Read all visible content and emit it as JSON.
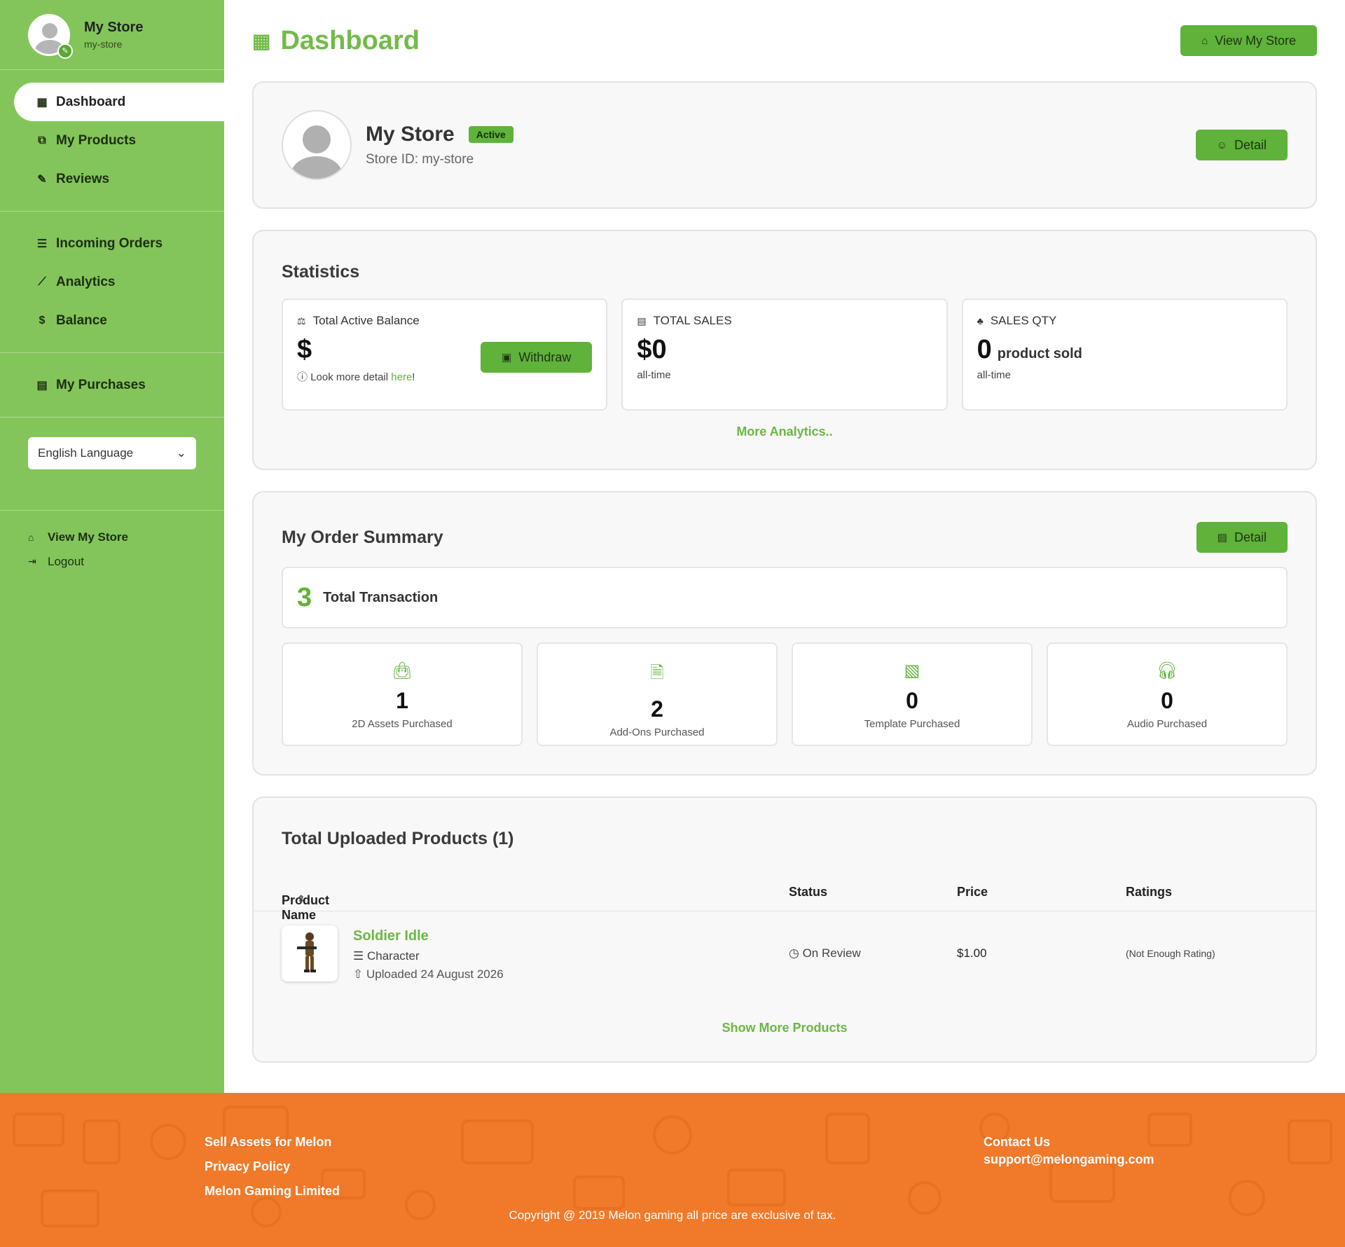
{
  "colors": {
    "sidebar": "#83c55a",
    "accent": "#5fb23a",
    "footer": "#f07a2a"
  },
  "sidebar": {
    "store_name": "My Store",
    "store_slug": "my-store",
    "nav_main": [
      {
        "label": "Dashboard",
        "icon": "dashboard-icon"
      },
      {
        "label": "My Products",
        "icon": "products-icon"
      },
      {
        "label": "Reviews",
        "icon": "pencil-icon"
      }
    ],
    "nav_orders": [
      {
        "label": "Incoming Orders",
        "icon": "list-icon"
      },
      {
        "label": "Analytics",
        "icon": "chart-icon"
      },
      {
        "label": "Balance",
        "icon": "dollar-icon"
      }
    ],
    "nav_purchases": [
      {
        "label": "My Purchases",
        "icon": "clipboard-icon"
      }
    ],
    "language": "English Language",
    "view_store": "View My Store",
    "logout": "Logout"
  },
  "header": {
    "title": "Dashboard",
    "view_store_btn": "View My Store"
  },
  "store": {
    "name": "My Store",
    "status": "Active",
    "store_id": "Store ID: my-store",
    "detail_btn": "Detail"
  },
  "statistics": {
    "title": "Statistics",
    "balance": {
      "label": "Total Active Balance",
      "value": "$",
      "withdraw": "Withdraw",
      "note_prefix": "Look more detail ",
      "note_link": "here",
      "note_suffix": "!"
    },
    "sales": {
      "label": "TOTAL SALES",
      "value": "$0",
      "sub": "all-time"
    },
    "qty": {
      "label": "SALES QTY",
      "value": "0",
      "unit": "product sold",
      "sub": "all-time"
    },
    "more": "More Analytics.."
  },
  "orders": {
    "title": "My Order Summary",
    "detail_btn": "Detail",
    "total_count": "3",
    "total_label": "Total Transaction",
    "categories": [
      {
        "count": "1",
        "label": "2D Assets Purchased",
        "icon": "shopping-bag-icon"
      },
      {
        "count": "2",
        "label": "Add-Ons Purchased",
        "icon": "document-icon"
      },
      {
        "count": "0",
        "label": "Template Purchased",
        "icon": "images-icon"
      },
      {
        "count": "0",
        "label": "Audio Purchased",
        "icon": "headphones-icon"
      }
    ]
  },
  "products": {
    "title": "Total Uploaded Products (1)",
    "columns": [
      "Product Name",
      "Status",
      "Price",
      "Ratings"
    ],
    "rows": [
      {
        "name": "Soldier Idle",
        "category": "Character",
        "uploaded": "Uploaded 24 August 2026",
        "status": "On Review",
        "price": "$1.00",
        "rating": "(Not Enough Rating)"
      }
    ],
    "show_more": "Show More Products"
  },
  "footer": {
    "links": [
      "Sell Assets for Melon",
      "Privacy Policy",
      "Melon Gaming Limited"
    ],
    "contact_title": "Contact Us",
    "contact_email": "support@melongaming.com",
    "copyright": "Copyright @ 2019 Melon gaming all price are exclusive of tax."
  }
}
